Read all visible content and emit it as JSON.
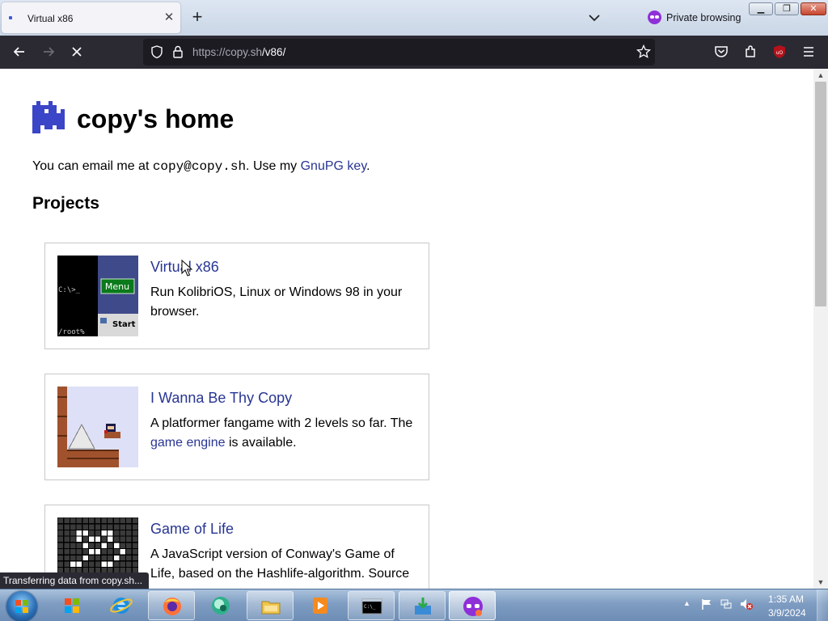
{
  "browser": {
    "tab_title": "Virtual x86",
    "tab_close_glyph": "✕",
    "new_tab_glyph": "+",
    "private_label": "Private browsing",
    "url_host": "https://copy.sh",
    "url_path": "/v86/",
    "icons": [
      "back-arrow-icon",
      "forward-arrow-icon",
      "stop-icon",
      "shield-icon",
      "lock-icon",
      "star-icon",
      "pocket-icon",
      "extensions-icon",
      "ublock-icon",
      "hamburger-menu-icon"
    ]
  },
  "page": {
    "title": "copy's home",
    "contact_prefix": "You can email me at ",
    "email": "copy@copy.sh",
    "contact_mid": ". Use my ",
    "gnupg_link": "GnuPG key",
    "contact_end": ".",
    "projects_heading": "Projects",
    "projects": [
      {
        "title": "Virtual x86",
        "desc": "Run KolibriOS, Linux or Windows 98 in your browser.",
        "thumb": {
          "prompt": "C:\\>_",
          "menu": "Menu",
          "root": "/root%",
          "start": "Start"
        }
      },
      {
        "title": "I Wanna Be Thy Copy",
        "desc_before": "A platformer fangame with 2 levels so far. The ",
        "desc_link": "game engine",
        "desc_after": " is available."
      },
      {
        "title": "Game of Life",
        "desc": "A JavaScript version of Conway's Game of Life, based on the Hashlife-algorithm. Source"
      }
    ]
  },
  "status_text": "Transferring data from copy.sh...",
  "taskbar": {
    "items": [
      "windows-media-center-icon",
      "internet-explorer-icon",
      "firefox-icon",
      "app-icon",
      "file-explorer-icon",
      "media-player-icon",
      "command-prompt-icon",
      "installer-icon",
      "firefox-private-icon"
    ],
    "clock_time": "1:35 AM",
    "clock_date": "3/9/2024"
  },
  "colors": {
    "link": "#283593",
    "chrome_dark": "#2b2a33",
    "private_purple": "#8f2fd8"
  }
}
